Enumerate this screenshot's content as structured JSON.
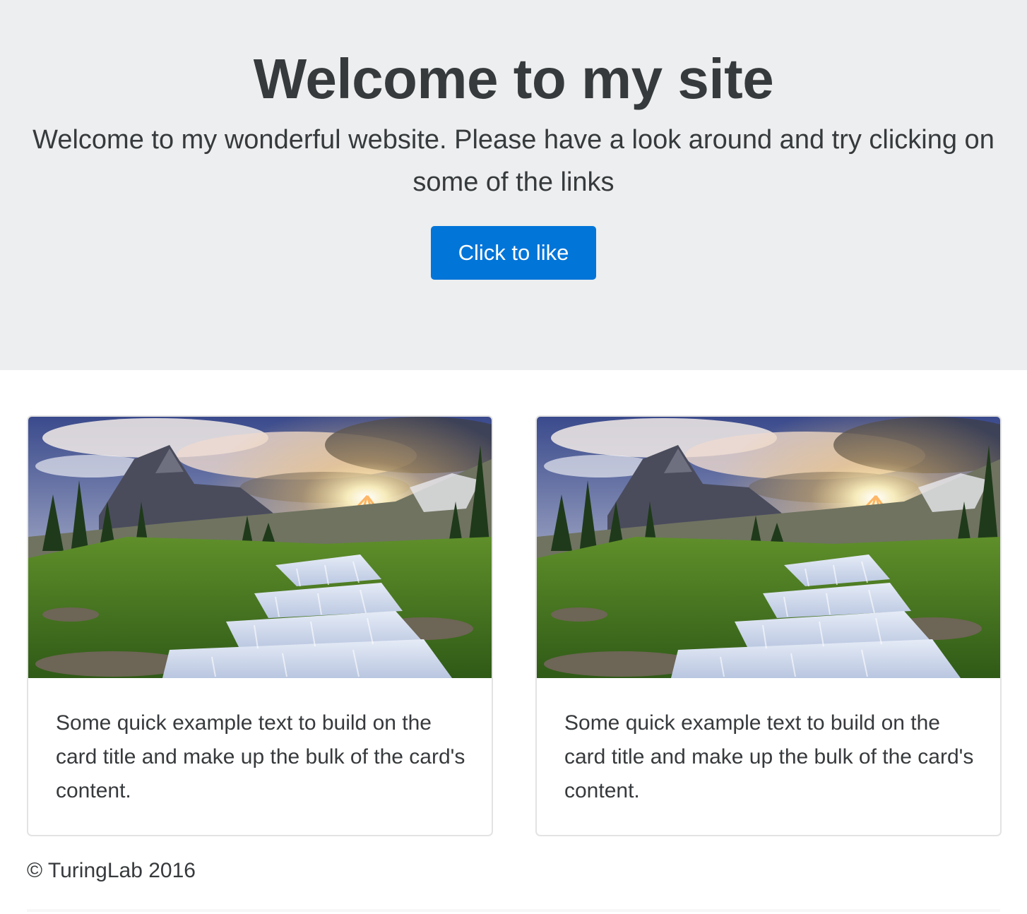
{
  "jumbotron": {
    "title": "Welcome to my site",
    "lead": "Welcome to my wonderful website. Please have a look around and try clicking on some of the links",
    "button_label": "Click to like"
  },
  "cards": [
    {
      "image": "mountain-waterfall-sunset-photo",
      "text": "Some quick example text to build on the card title and make up the bulk of the card's content."
    },
    {
      "image": "mountain-waterfall-sunset-photo",
      "text": "Some quick example text to build on the card title and make up the bulk of the card's content."
    }
  ],
  "footer": {
    "copyright": "© TuringLab 2016"
  },
  "colors": {
    "jumbotron_bg": "#eceeef",
    "primary_button": "#0275d8",
    "text": "#373a3c",
    "card_border": "#e3e3e3"
  }
}
